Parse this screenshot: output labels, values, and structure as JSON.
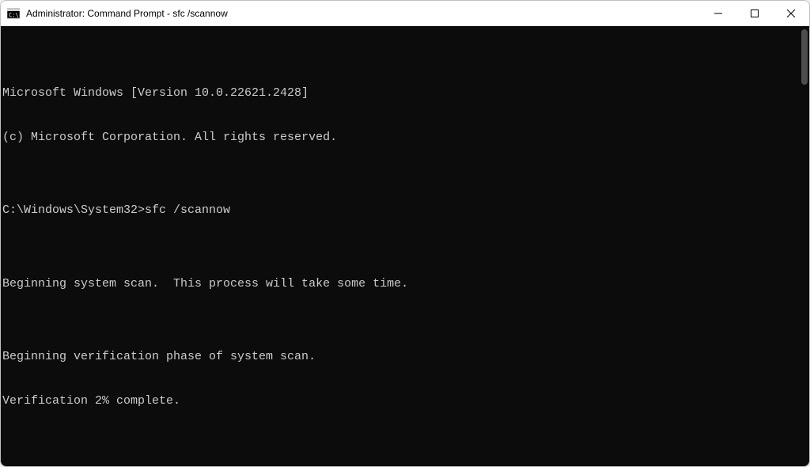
{
  "window": {
    "title": "Administrator: Command Prompt - sfc  /scannow"
  },
  "terminal": {
    "lines": [
      "Microsoft Windows [Version 10.0.22621.2428]",
      "(c) Microsoft Corporation. All rights reserved.",
      "",
      "C:\\Windows\\System32>sfc /scannow",
      "",
      "Beginning system scan.  This process will take some time.",
      "",
      "Beginning verification phase of system scan.",
      "Verification 2% complete."
    ]
  }
}
